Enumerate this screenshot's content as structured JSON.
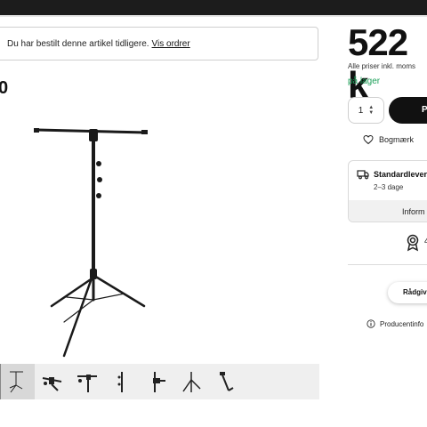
{
  "notice": {
    "text": "Du har bestilt denne artikel tidligere.",
    "link": "Vis ordrer"
  },
  "product": {
    "title_fragment": "0"
  },
  "price": {
    "amount": "522 k",
    "note": "Alle priser inkl. moms",
    "stock": "på lager",
    "stock_color": "#1ea05a"
  },
  "cart": {
    "quantity": "1",
    "buy_label": "P"
  },
  "bookmark": {
    "label": "Bogmærk"
  },
  "delivery": {
    "title": "Standardlever",
    "days": "2–3 dage",
    "info": "Inform"
  },
  "award": {
    "text": "4"
  },
  "advice": {
    "label": "Rådgiv"
  },
  "producer": {
    "label": "Producentinfo"
  },
  "thumbnails": [
    "stand-full",
    "boom-clamp",
    "boom-arm",
    "pole-section",
    "clamp-detail",
    "tripod-base",
    "base-angle"
  ]
}
